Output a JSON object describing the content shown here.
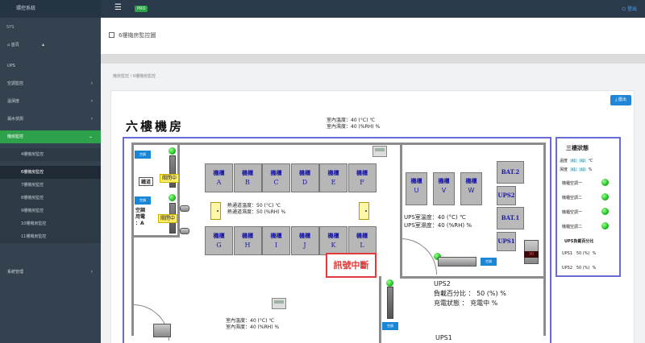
{
  "app": {
    "brand": "環控系統",
    "top_badge": "PRO",
    "user": "登出"
  },
  "sidebar": {
    "section_label": "SYS",
    "home": "首頁",
    "items": [
      {
        "label": "UPS"
      },
      {
        "label": "空調監控"
      },
      {
        "label": "溫濕度"
      },
      {
        "label": "漏水偵測"
      },
      {
        "label": "機房監控",
        "active": true
      }
    ],
    "sub_items": [
      "4樓機房監控",
      "6樓機房監控",
      "7樓機房監控",
      "8樓機房監控",
      "9樓機房監控",
      "10樓機房監控",
      "11樓機房監控"
    ],
    "bottom_item": "系統管理"
  },
  "page": {
    "title": "6樓機房監控圖",
    "breadcrumb": "機房監控 / 6樓機房監控",
    "export": "匯出"
  },
  "room": {
    "title": "六樓機房",
    "indoor_top": [
      "室內溫度：40 (°C) ℃",
      "室內濕度：40 (%RH) %"
    ],
    "ac_left_top": {
      "btn": "空調",
      "label": "鐵道",
      "status": "關閉中"
    },
    "ac_left_mid": {
      "btn": "空調",
      "status": "關閉中"
    },
    "ac_panel_label": [
      "空調",
      "用電",
      "：A"
    ],
    "racks_top": [
      {
        "name": "機櫃",
        "letter": "A"
      },
      {
        "name": "機櫃",
        "letter": "B"
      },
      {
        "name": "機櫃",
        "letter": "C"
      },
      {
        "name": "機櫃",
        "letter": "D"
      },
      {
        "name": "機櫃",
        "letter": "E"
      },
      {
        "name": "機櫃",
        "letter": "F"
      }
    ],
    "racks_bottom": [
      {
        "name": "機櫃",
        "letter": "G"
      },
      {
        "name": "機櫃",
        "letter": "H"
      },
      {
        "name": "機櫃",
        "letter": "I"
      },
      {
        "name": "機櫃",
        "letter": "J"
      },
      {
        "name": "機櫃",
        "letter": "K"
      },
      {
        "name": "機櫃",
        "letter": "L"
      }
    ],
    "aisle_temp": "熱通道溫度：50 (°C) ℃",
    "aisle_humid": "熱通道濕度：50 (%RH) %",
    "signal_lost": "訊號中斷",
    "ups_racks": [
      {
        "name": "機櫃",
        "letter": "U"
      },
      {
        "name": "機櫃",
        "letter": "V"
      },
      {
        "name": "機櫃",
        "letter": "W"
      }
    ],
    "ups_room_temp": "UPS室溫度：40 (°C) ℃",
    "ups_room_humid": "UPS室濕度：40 (%RH) %",
    "bat2": "BAT.2",
    "ups2_box": "UPS2",
    "bat1": "BAT.1",
    "ups1_box": "UPS1",
    "ups2_title": "UPS2",
    "ups2_load": "負載百分比 ： 50 (%) %",
    "ups2_charge": "充電狀態 ： 充電中 %",
    "ups1_title": "UPS1",
    "bottom_temp": "室內溫度：40 (°C) ℃",
    "bottom_humid": "室內濕度：40 (%RH) %",
    "right_ac_btn": "空調",
    "left_bottom_btn": "空調",
    "device_code": "30"
  },
  "status_panel": {
    "title": "三樓狀態",
    "temp_label": "溫度",
    "humid_label": "濕度",
    "temp_vals": [
      "A1",
      "A2"
    ],
    "humid_vals": [
      "A1",
      "A2"
    ],
    "temp_unit": "℃",
    "humid_unit": "%",
    "ac_rows": [
      "機櫃空調一",
      "機櫃空調二",
      "機櫃空調一",
      "機櫃空調二"
    ],
    "ups_header": "UPS負載百分比",
    "ups1": {
      "label": "UPS1",
      "val": "50 (%)",
      "unit": "%"
    },
    "ups2": {
      "label": "UPS2",
      "val": "50 (%)",
      "unit": "%"
    }
  }
}
